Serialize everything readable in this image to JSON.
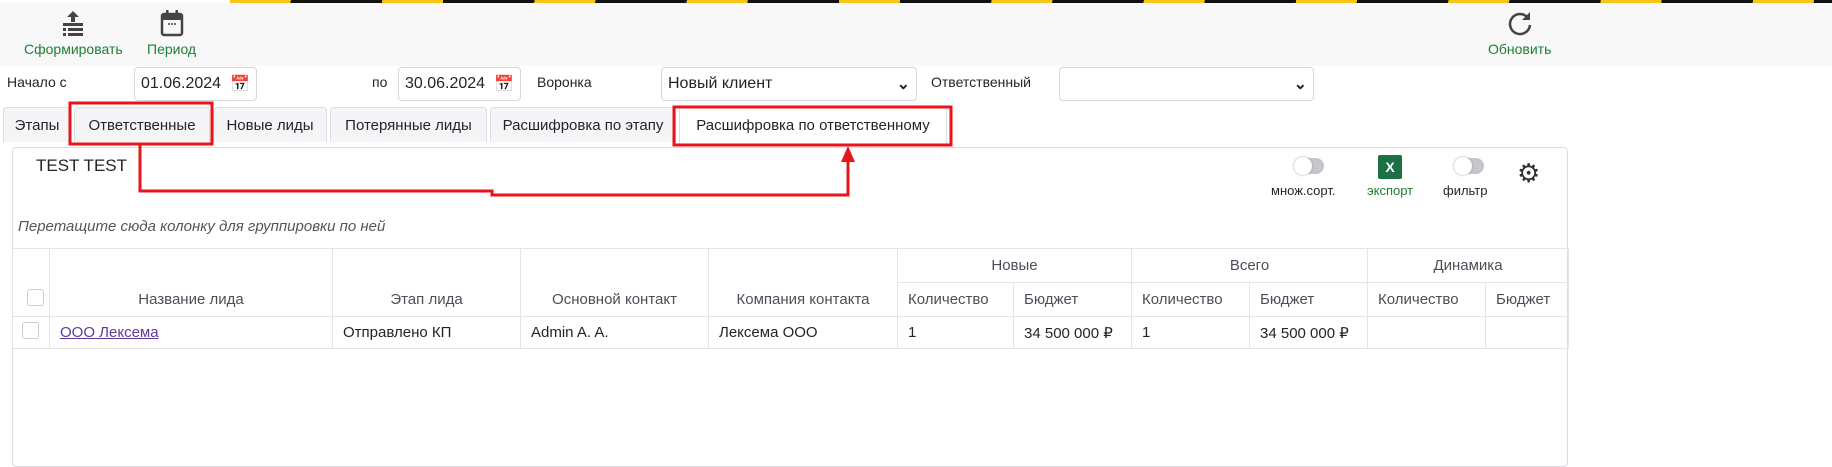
{
  "toolbar": {
    "generate": "Сформировать",
    "period": "Период",
    "refresh": "Обновить"
  },
  "filters": {
    "start_label": "Начало с",
    "start_value": "01.06.2024",
    "to_label": "по",
    "end_value": "30.06.2024",
    "funnel_label": "Воронка",
    "funnel_value": "Новый клиент",
    "responsible_label": "Ответственный",
    "responsible_value": ""
  },
  "tabs": [
    "Этапы",
    "Ответственные",
    "Новые лиды",
    "Потерянные лиды",
    "Расшифровка по этапу",
    "Расшифровка по ответственному"
  ],
  "panel": {
    "title": "TEST TEST",
    "multisort": "множ.сорт.",
    "export": "экспорт",
    "export_icon": "X",
    "filter": "фильтр",
    "group_hint": "Перетащите сюда колонку для группировки по ней"
  },
  "table": {
    "groups": [
      "Новые",
      "Всего",
      "Динамика"
    ],
    "columns": [
      "Название лида",
      "Этап лида",
      "Основной контакт",
      "Компания контакта"
    ],
    "subcolumns": [
      "Количество",
      "Бюджет",
      "Количество",
      "Бюджет",
      "Количество",
      "Бюджет"
    ],
    "rows": [
      {
        "name": "ООО Лексема",
        "stage": "Отправлено КП",
        "contact": "Admin A. A.",
        "company": "Лексема ООО",
        "values": [
          "1",
          "34 500 000 ₽",
          "1",
          "34 500 000 ₽",
          "",
          ""
        ]
      }
    ]
  },
  "colors": {
    "accent_green": "#1e7e34",
    "annotation_red": "#e8141c"
  }
}
